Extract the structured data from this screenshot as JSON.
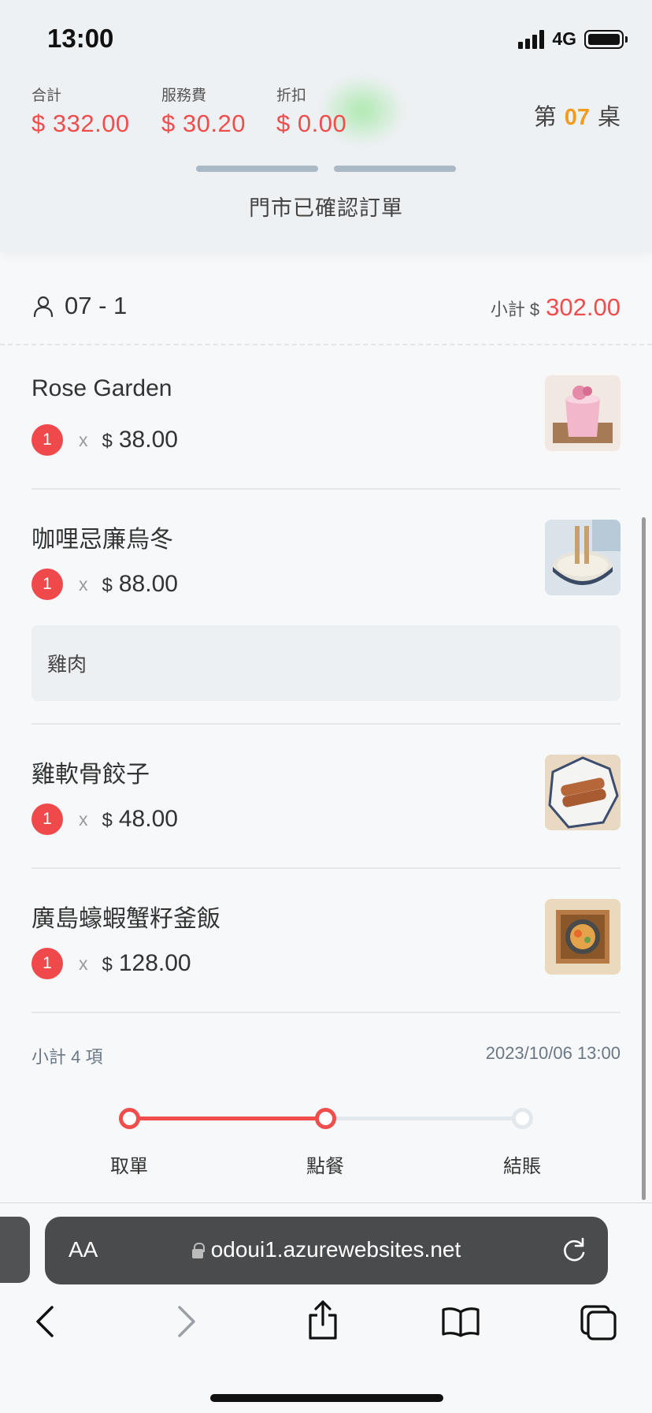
{
  "status_bar": {
    "time": "13:00",
    "network": "4G"
  },
  "summary": {
    "total_label": "合計",
    "total_value": "$ 332.00",
    "service_label": "服務費",
    "service_value": "$ 30.20",
    "discount_label": "折扣",
    "discount_value": "$ 0.00"
  },
  "table": {
    "prefix": "第",
    "number": "07",
    "suffix": "桌"
  },
  "order_status": "門市已確認訂單",
  "guest": {
    "id": "07 - 1",
    "subtotal_label": "小計 $",
    "subtotal_value": "302.00"
  },
  "items": [
    {
      "name": "Rose Garden",
      "qty": "1",
      "times": "x",
      "currency": "$",
      "price": "38.00"
    },
    {
      "name": "咖哩忌廉烏冬",
      "qty": "1",
      "times": "x",
      "currency": "$",
      "price": "88.00",
      "note": "雞肉"
    },
    {
      "name": "雞軟骨餃子",
      "qty": "1",
      "times": "x",
      "currency": "$",
      "price": "48.00"
    },
    {
      "name": "廣島蠔蝦蟹籽釜飯",
      "qty": "1",
      "times": "x",
      "currency": "$",
      "price": "128.00"
    }
  ],
  "footer": {
    "count_text": "小計 4 項",
    "datetime": "2023/10/06 13:00"
  },
  "steps": [
    {
      "label": "取單",
      "state": "done"
    },
    {
      "label": "點餐",
      "state": "current"
    },
    {
      "label": "結賬",
      "state": "todo"
    }
  ],
  "browser": {
    "aa_label": "AA",
    "url": "odoui1.azurewebsites.net"
  },
  "colors": {
    "accent": "#f04d4d",
    "table_number": "#f29b1d"
  }
}
